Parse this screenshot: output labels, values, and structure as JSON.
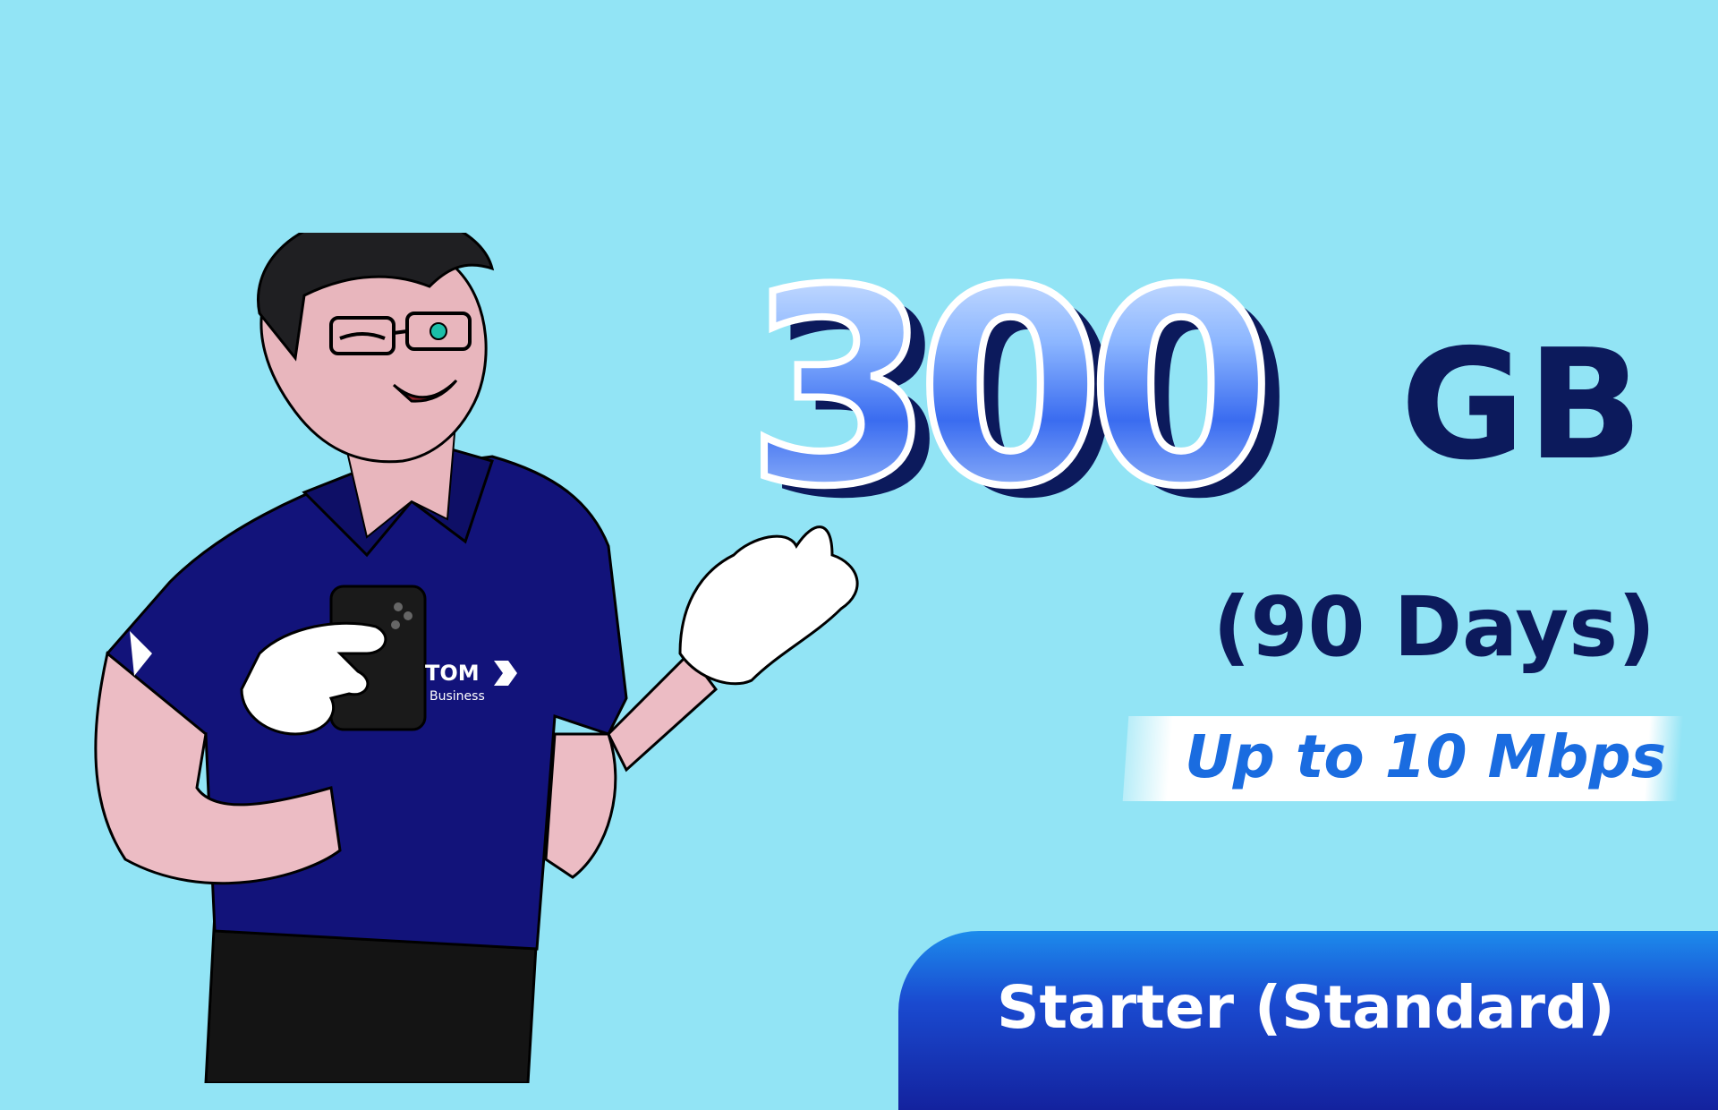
{
  "offer": {
    "data_amount": "300",
    "data_unit": "GB",
    "duration": "(90 Days)",
    "speed": "Up to 10 Mbps",
    "plan_name": "Starter (Standard)"
  },
  "shirt_logo": {
    "brand": "TOM",
    "tagline": "Business"
  },
  "colors": {
    "background": "#92e4f5",
    "navy": "#0c1a5c",
    "accent_blue": "#1a6ce0",
    "shirt": "#12137a"
  }
}
